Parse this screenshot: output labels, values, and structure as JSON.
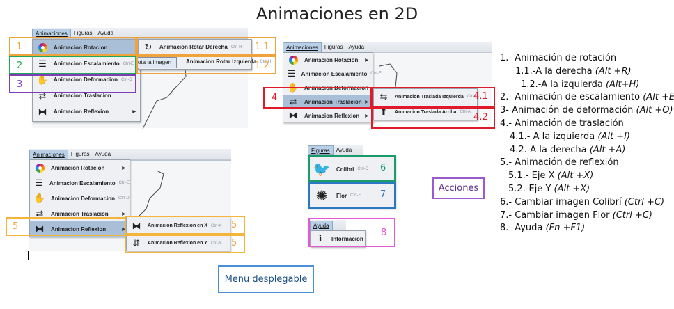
{
  "title": "Animaciones en 2D",
  "menubar": {
    "animaciones": "Animaciones",
    "figuras": "Figuras",
    "ayuda": "Ayuda"
  },
  "main_menu": [
    {
      "label": "Animacion Rotacion",
      "icon": "color-wheel-icon"
    },
    {
      "label": "Animacion Escalamiento",
      "icon": "scale-lines-icon",
      "accel": "Ctrl-E"
    },
    {
      "label": "Animacion Deformacion",
      "icon": "deform-hand-icon",
      "accel": "Ctrl-D"
    },
    {
      "label": "Animacion Traslacion",
      "icon": "swap-arrows-icon"
    },
    {
      "label": "Animacion Reflexion",
      "icon": "reflect-icon"
    }
  ],
  "rotation_submenu": [
    {
      "label": "Animacion Rotar Derecha",
      "accel": "Ctrl-R"
    },
    {
      "label": "Animacion Rotar Izquierda",
      "accel": "Ctrl-H"
    }
  ],
  "rotation_tooltip": "ota la imagen",
  "translation_submenu": [
    {
      "label": "Animacion Traslada Izquierda",
      "accel": "Ctrl-I"
    },
    {
      "label": "Animacion Traslada Arriba",
      "accel": "Ctrl-A"
    }
  ],
  "reflection_submenu": [
    {
      "label": "Animacion Reflexion en X",
      "accel": "Ctrl-X"
    },
    {
      "label": "Animacion Reflexion en Y",
      "accel": "Ctrl-Y"
    }
  ],
  "figuras_menu": [
    {
      "label": "Colibri",
      "accel": "Ctrl-C",
      "icon": "hummingbird-icon"
    },
    {
      "label": "Flor",
      "accel": "Ctrl-F",
      "icon": "flower-icon"
    }
  ],
  "ayuda_menu": [
    {
      "label": "Informacion",
      "icon": "info-icon"
    }
  ],
  "markers": {
    "m1": "1",
    "m11": "1.1",
    "m12": "1.2",
    "m2": "2",
    "m3": "3",
    "m4": "4",
    "m41": "4.1",
    "m42": "4.2",
    "m5a": "5",
    "m5b": "5",
    "m5c": "5",
    "m6": "6",
    "m7": "7",
    "m8": "8"
  },
  "colors": {
    "orange": "#f0a33a",
    "green": "#1faa59",
    "purple": "#7e3fb5",
    "red": "#e01a2a",
    "yellow": "#f5b53a",
    "teal": "#1a9b6a",
    "blue": "#2b77c2",
    "pink": "#e857d6",
    "acciones": "#9b5bd0",
    "menu_box": "#4a90d9"
  },
  "actions_list": [
    "1.- Animación de rotación",
    "1.1.-A la derecha (Alt +R)",
    "1.2.-A la izquierda (Alt+H)",
    "2.- Animación de escalamiento (Alt +E)",
    "3- Animación de deformación (Alt +O)",
    "4.- Animación de traslación",
    "4.1.- A la izquierda (Alt +I)",
    "4.2.-A la derecha (Alt +A)",
    "5.- Animación de reflexión",
    "5.1.- Eje X (Alt +X)",
    "5.2.-Eje Y (Alt +X)",
    "6.- Cambiar imagen Colibrí (Ctrl +C)",
    "7.- Cambiar imagen Flor (Ctrl +C)",
    "8.- Ayuda (Fn +F1)"
  ],
  "acciones_label": "Acciones",
  "menu_desplegable_label": "Menu desplegable"
}
